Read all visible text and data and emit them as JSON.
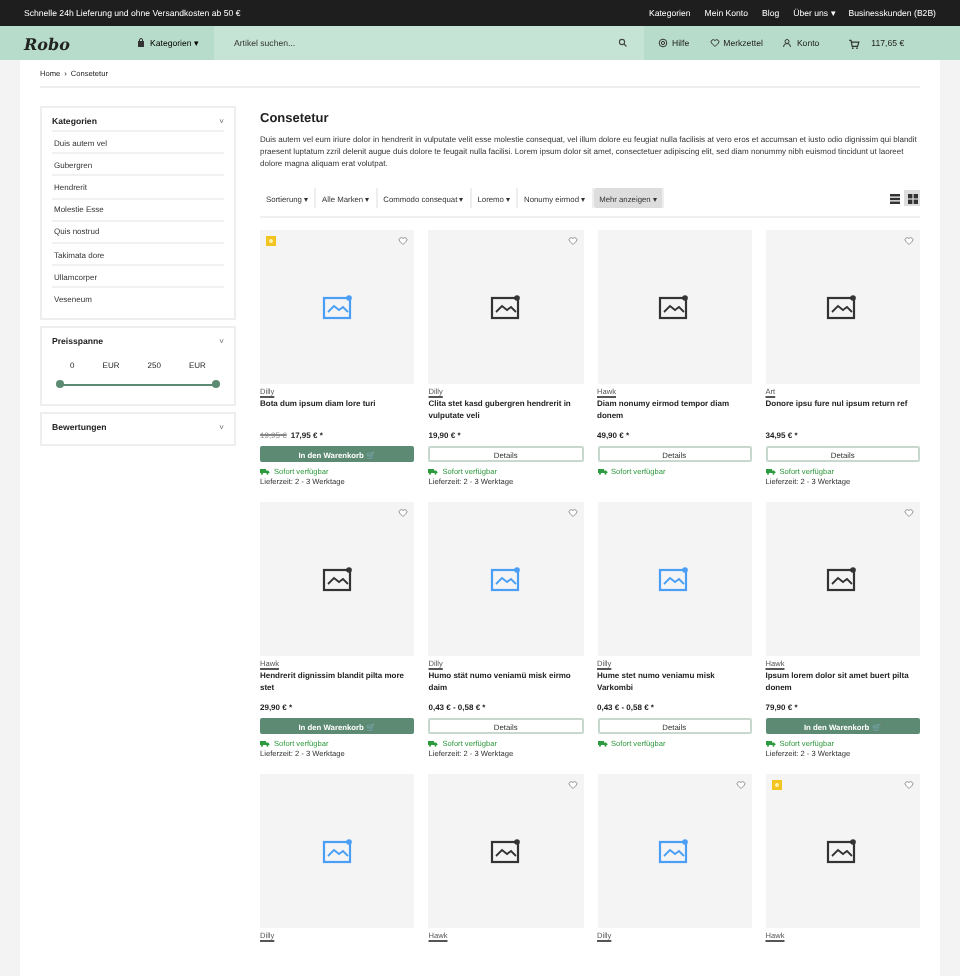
{
  "top_bar": {
    "promo": "Schnelle 24h Lieferung und ohne Versandkosten ab 50 €",
    "links": [
      "Kategorien",
      "Mein Konto",
      "Blog",
      "Über uns ▾",
      "Businesskunden (B2B)"
    ]
  },
  "header": {
    "logo": "Robo",
    "categories": "Kategorien ▾",
    "search": {
      "placeholder": "Artikel suchen..."
    },
    "actions": [
      {
        "kind": "help",
        "label": "Hilfe"
      },
      {
        "kind": "wishlist",
        "label": "Merkzettel"
      },
      {
        "kind": "account",
        "label": "Konto"
      },
      {
        "kind": "cart",
        "label": "117,65 €"
      }
    ]
  },
  "breadcrumb": [
    "Home",
    "›",
    "Consetetur"
  ],
  "sidebar": [
    {
      "title": "Kategorien",
      "caret": "˅",
      "items": [
        "Duis autem vel",
        "Gubergren",
        "Hendrerit",
        "Molestie Esse",
        "Quis nostrud",
        "Takimata dore",
        "Ullamcorper",
        "Veseneum"
      ]
    },
    {
      "title": "Preisspanne",
      "caret": "˅",
      "price": {
        "min": "0",
        "min_unit": "EUR",
        "max": "250",
        "max_unit": "EUR",
        "level": 1
      }
    },
    {
      "title": "Bewertungen",
      "caret": "˅"
    }
  ],
  "main": {
    "title": "Consetetur",
    "description": "Duis autem vel eum iriure dolor in hendrerit in vulputate velit esse molestie consequat, vel illum dolore eu feugiat nulla facilisis at vero eros et accumsan et iusto odio dignissim qui blandit praesent luptatum zzril delenit augue duis dolore te feugait nulla facilisi. Lorem ipsum dolor sit amet, consectetuer adipiscing elit, sed diam nonummy nibh euismod tincidunt ut laoreet dolore magna aliquam erat volutpat.",
    "filters": [
      {
        "kind": "filter",
        "label": "Sortierung ▾"
      },
      {
        "kind": "filter",
        "label": "Alle Marken ▾"
      },
      {
        "kind": "filter",
        "label": "Commodo consequat ▾"
      },
      {
        "kind": "filter",
        "label": "Loremo ▾"
      },
      {
        "kind": "filter",
        "label": "Nonumy eirmod ▾"
      },
      {
        "kind": "more",
        "label": "Mehr anzeigen ▾"
      }
    ],
    "views": [
      {
        "kind": "list",
        "selected": false
      },
      {
        "kind": "grid",
        "selected": true
      }
    ],
    "products": [
      {
        "badge": true,
        "wishlist_icon": true,
        "color": "#4a9ff5",
        "brand": "Dilly",
        "name": "Bota dum ipsum diam lore turi",
        "old_price": "19,95 €",
        "price": "17,95 € *",
        "button": {
          "kind": "cart",
          "label": "In den Warenkorb 🛒"
        },
        "stock": "Sofort verfügbar",
        "delivery": "Lieferzeit: 2 - 3 Werktage"
      },
      {
        "badge": false,
        "wishlist_icon": true,
        "color": "#333333",
        "brand": "Dilly",
        "name": "Clita stet kasd gubergren hendrerit in vulputate veli",
        "price": "19,90 € *",
        "button": {
          "kind": "details",
          "label": "Details"
        },
        "stock": "Sofort verfügbar",
        "delivery": "Lieferzeit: 2 - 3 Werktage"
      },
      {
        "badge": false,
        "wishlist_icon": false,
        "color": "#333333",
        "brand": "Hawk",
        "name": "Diam nonumy eirmod tempor diam donem",
        "price": "49,90 € *",
        "button": {
          "kind": "details",
          "label": "Details"
        },
        "stock": "Sofort verfügbar"
      },
      {
        "badge": false,
        "wishlist_icon": true,
        "color": "#333333",
        "brand": "Art",
        "name": "Donore ipsu fure nul ipsum return ref",
        "price": "34,95 € *",
        "button": {
          "kind": "details",
          "label": "Details"
        },
        "stock": "Sofort verfügbar",
        "delivery": "Lieferzeit: 2 - 3 Werktage"
      },
      {
        "badge": false,
        "wishlist_icon": true,
        "color": "#333333",
        "brand": "Hawk",
        "name": "Hendrerit dignissim blandit pilta more stet",
        "price": "29,90 € *",
        "button": {
          "kind": "cart",
          "label": "In den Warenkorb 🛒"
        },
        "stock": "Sofort verfügbar",
        "delivery": "Lieferzeit: 2 - 3 Werktage"
      },
      {
        "badge": false,
        "wishlist_icon": true,
        "color": "#4a9ff5",
        "brand": "Dilly",
        "name": "Humo stät numo veniamü misk eirmo daim",
        "price": "0,43 € - 0,58 € *",
        "button": {
          "kind": "details",
          "label": "Details"
        },
        "stock": "Sofort verfügbar",
        "delivery": "Lieferzeit: 2 - 3 Werktage"
      },
      {
        "badge": false,
        "wishlist_icon": false,
        "color": "#4a9ff5",
        "brand": "Dilly",
        "name": "Hume stet numo veniamu misk Varkombi",
        "price": "0,43 € - 0,58 € *",
        "button": {
          "kind": "details",
          "label": "Details"
        },
        "stock": "Sofort verfügbar"
      },
      {
        "badge": false,
        "wishlist_icon": true,
        "color": "#333333",
        "brand": "Hawk",
        "name": "Ipsum lorem dolor sit amet buert pilta donem",
        "price": "79,90 € *",
        "button": {
          "kind": "cart",
          "label": "In den Warenkorb 🛒"
        },
        "stock": "Sofort verfügbar",
        "delivery": "Lieferzeit: 2 - 3 Werktage"
      },
      {
        "badge": false,
        "wishlist_icon": false,
        "color": "#4a9ff5",
        "brand": "Dilly"
      },
      {
        "badge": false,
        "wishlist_icon": true,
        "color": "#333333",
        "brand": "Hawk"
      },
      {
        "badge": false,
        "wishlist_icon": true,
        "color": "#4a9ff5",
        "brand": "Dilly"
      },
      {
        "badge": true,
        "wishlist_icon": true,
        "color": "#333333",
        "brand": "Hawk"
      }
    ]
  }
}
